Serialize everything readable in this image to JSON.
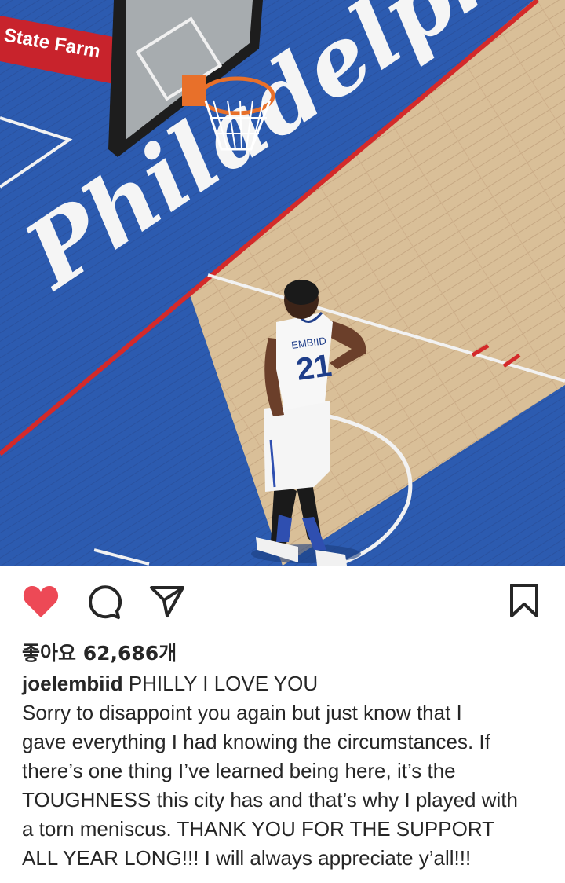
{
  "post": {
    "image": {
      "arena_text": "Philadelphia",
      "sponsor_text": "State Farm",
      "jersey_name": "EMBIID",
      "jersey_number": "21"
    },
    "actions": {
      "like_icon": "heart-filled-icon",
      "comment_icon": "comment-icon",
      "share_icon": "paper-plane-icon",
      "save_icon": "bookmark-icon",
      "like_color": "#ed4956"
    },
    "likes_label": "좋아요",
    "likes_count": "62,686",
    "likes_unit": "개",
    "caption": {
      "username": "joelembiid",
      "headline": "PHILLY I LOVE YOU",
      "lines": [
        "Sorry to disappoint you again but just know that I",
        "gave everything I had knowing the circumstances. If",
        "there’s one thing I’ve learned being here, it’s the",
        "TOUGHNESS this city has and that’s why I played with",
        "a torn meniscus. THANK YOU FOR THE SUPPORT",
        "ALL YEAR LONG!!! I will always appreciate y’all!!!"
      ]
    }
  }
}
